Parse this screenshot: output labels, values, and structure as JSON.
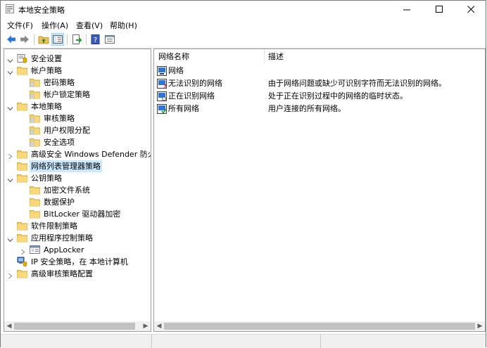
{
  "window": {
    "title": "本地安全策略"
  },
  "menu": [
    "文件(F)",
    "操作(A)",
    "查看(V)",
    "帮助(H)"
  ],
  "tree": [
    {
      "label": "安全设置",
      "icon": "security-settings-icon",
      "expand": "open"
    },
    {
      "label": "帐户策略",
      "icon": "folder-icon",
      "expand": "open"
    },
    {
      "label": "密码策略",
      "icon": "policy-folder-icon",
      "expand": ""
    },
    {
      "label": "帐户锁定策略",
      "icon": "policy-folder-icon",
      "expand": ""
    },
    {
      "label": "本地策略",
      "icon": "folder-icon",
      "expand": "open"
    },
    {
      "label": "审核策略",
      "icon": "policy-folder-icon",
      "expand": ""
    },
    {
      "label": "用户权限分配",
      "icon": "policy-folder-icon",
      "expand": ""
    },
    {
      "label": "安全选项",
      "icon": "policy-folder-icon",
      "expand": ""
    },
    {
      "label": "高级安全 Windows Defender 防火墙",
      "icon": "folder-icon",
      "expand": "closed"
    },
    {
      "label": "网络列表管理器策略",
      "icon": "folder-icon",
      "expand": "",
      "selected": true
    },
    {
      "label": "公钥策略",
      "icon": "folder-icon",
      "expand": "open"
    },
    {
      "label": "加密文件系统",
      "icon": "folder-icon",
      "expand": ""
    },
    {
      "label": "数据保护",
      "icon": "folder-icon",
      "expand": ""
    },
    {
      "label": "BitLocker 驱动器加密",
      "icon": "folder-icon",
      "expand": ""
    },
    {
      "label": "软件限制策略",
      "icon": "folder-icon",
      "expand": ""
    },
    {
      "label": "应用程序控制策略",
      "icon": "folder-icon",
      "expand": "open"
    },
    {
      "label": "AppLocker",
      "icon": "applocker-icon",
      "expand": "closed"
    },
    {
      "label": "IP 安全策略，在 本地计算机",
      "icon": "ip-security-icon",
      "expand": ""
    },
    {
      "label": "高级审核策略配置",
      "icon": "folder-icon",
      "expand": "closed"
    }
  ],
  "list": {
    "columns": [
      "网络名称",
      "描述"
    ],
    "rows": [
      {
        "name": "网络",
        "desc": "",
        "icon": "network-icon"
      },
      {
        "name": "无法识别的网络",
        "desc": "由于网络问题或缺少可识别字符而无法识别的网络。",
        "icon": "unidentified-network-icon"
      },
      {
        "name": "正在识别网络",
        "desc": "处于正在识别过程中的网络的临时状态。",
        "icon": "identifying-network-icon"
      },
      {
        "name": "所有网络",
        "desc": "用户连接的所有网络。",
        "icon": "all-networks-icon"
      }
    ]
  },
  "colors": {
    "selection": "#cce8ff",
    "folder": "#e8c15a",
    "accent": "#2e75d6"
  }
}
